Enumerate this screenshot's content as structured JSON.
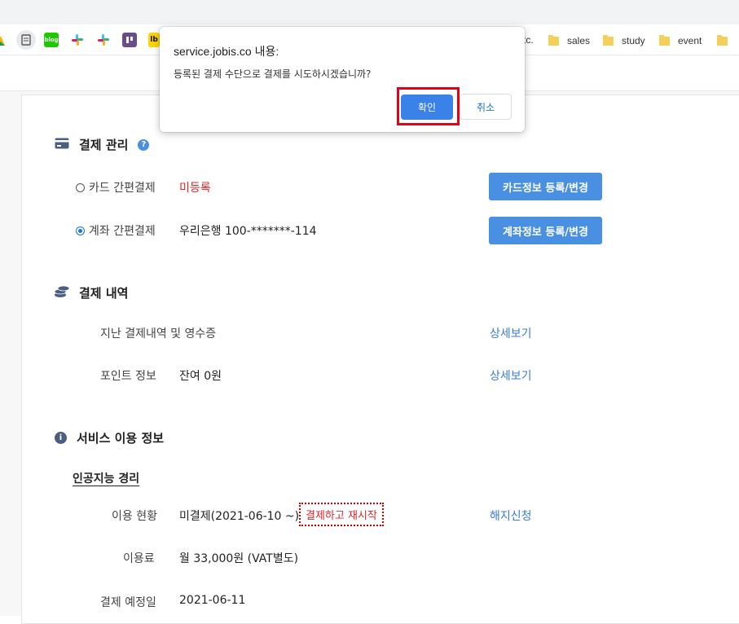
{
  "bookmarks": {
    "etc_label": "tc.",
    "folders": [
      "sales",
      "study",
      "event"
    ],
    "blog_label": "blog",
    "lb_label": "lb"
  },
  "dialog": {
    "title": "service.jobis.co 내용:",
    "message": "등록된 결제 수단으로 결제를 시도하시겠습니까?",
    "ok_label": "확인",
    "cancel_label": "취소"
  },
  "payment_management": {
    "title": "결제 관리",
    "card_option": {
      "label": "카드 간편결제",
      "status": "미등록",
      "button": "카드정보 등록/변경",
      "selected": false
    },
    "account_option": {
      "label": "계좌 간편결제",
      "value": "우리은행 100-*******-114",
      "button": "계좌정보 등록/변경",
      "selected": true
    }
  },
  "payment_history": {
    "title": "결제 내역",
    "rows": [
      {
        "label": "지난 결제내역 및 영수증",
        "value": "",
        "link": "상세보기"
      },
      {
        "label": "포인트 정보",
        "value": "잔여 0원",
        "link": "상세보기"
      }
    ]
  },
  "service_info": {
    "title": "서비스 이용 정보",
    "product": "인공지능 경리",
    "status_label": "이용 현황",
    "status_value": "미결제(2021-06-10 ~)",
    "retry_label": "결제하고 재시작",
    "cancel_link": "해지신청",
    "fee_label": "이용료",
    "fee_value": "월 33,000원 (VAT별도)",
    "due_label": "결제 예정일",
    "due_value": "2021-06-11"
  },
  "colors": {
    "accent": "#4a90e2",
    "warning": "#d8282b",
    "link": "#3a7bd5",
    "highlight": "#e60012"
  }
}
